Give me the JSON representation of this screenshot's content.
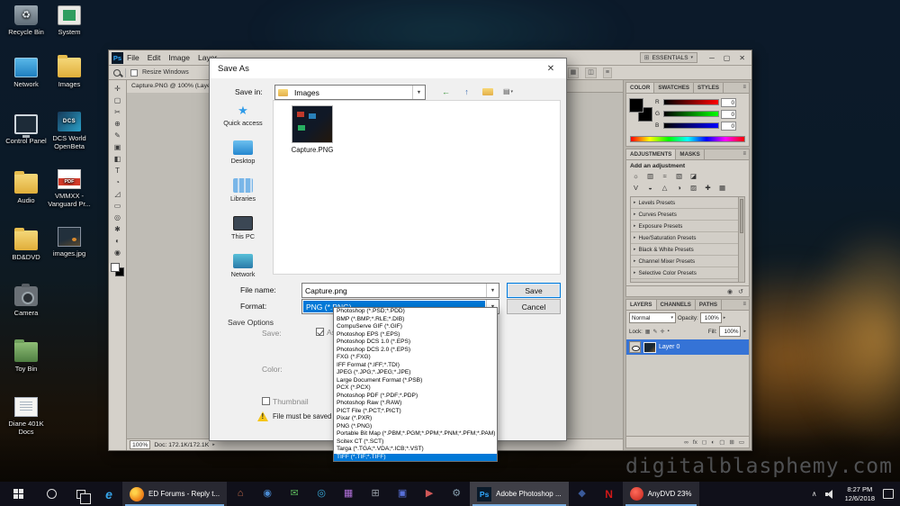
{
  "desktop": {
    "watermark": "digitalblasphemy.com",
    "icons": [
      {
        "label": "Recycle Bin",
        "type": "recycle"
      },
      {
        "label": "System",
        "type": "system"
      },
      {
        "label": "Network",
        "type": "network"
      },
      {
        "label": "Images",
        "type": "folder"
      },
      {
        "label": "Control Panel",
        "type": "monitor"
      },
      {
        "label": "DCS World OpenBeta",
        "type": "dcs"
      },
      {
        "label": "Audio",
        "type": "folder"
      },
      {
        "label": "VMMXX - Vanguard Pr...",
        "type": "pdf"
      },
      {
        "label": "BD&DVD",
        "type": "folder"
      },
      {
        "label": "images.jpg",
        "type": "image"
      },
      {
        "label": "Camera",
        "type": "camera"
      },
      {
        "label": "Toy Bin",
        "type": "greenfolder"
      },
      {
        "label": "Diane 401K Docs",
        "type": "docs"
      }
    ]
  },
  "photoshop": {
    "logo": "Ps",
    "menus": [
      "File",
      "Edit",
      "Image",
      "Layer"
    ],
    "workspace_label": "ESSENTIALS",
    "workspace_icon": "⊞",
    "window_controls": {
      "minimize": "─",
      "maximize": "▢",
      "close": "✕"
    },
    "panel_menu_icon": "≡",
    "options_bar": {
      "resize_label": "Resize Windows",
      "right_icons": [
        "▦",
        "◫",
        "≡"
      ]
    },
    "doc_tab": "Capture.PNG @ 100% (Layer 0",
    "tools": [
      "✛",
      "▢",
      "✂",
      "⊕",
      "✎",
      "▣",
      "◧",
      "T",
      "◔",
      "◿",
      "▭",
      "◎",
      "✱",
      "◐",
      "◉"
    ],
    "status": {
      "zoom": "100%",
      "doc": "Doc: 172.1K/172.1K"
    },
    "color_panel": {
      "tabs": [
        "COLOR",
        "SWATCHES",
        "STYLES"
      ],
      "channels": [
        {
          "label": "R",
          "value": "0"
        },
        {
          "label": "G",
          "value": "0"
        },
        {
          "label": "B",
          "value": "0"
        }
      ]
    },
    "adjustments_panel": {
      "tabs": [
        "ADJUSTMENTS",
        "MASKS"
      ],
      "heading": "Add an adjustment",
      "icons_row1": [
        "☼",
        "▥",
        "≈",
        "▧",
        "◪"
      ],
      "icons_row2": [
        "V",
        "◒",
        "△",
        "◑",
        "▨",
        "✚",
        "▦"
      ],
      "presets": [
        "Levels Presets",
        "Curves Presets",
        "Exposure Presets",
        "Hue/Saturation Presets",
        "Black & White Presets",
        "Channel Mixer Presets",
        "Selective Color Presets"
      ],
      "footer_icons": [
        "◉",
        "↺"
      ]
    },
    "layers_panel": {
      "tabs": [
        "LAYERS",
        "CHANNELS",
        "PATHS"
      ],
      "blend_mode": "Normal",
      "opacity_label": "Opacity:",
      "opacity_value": "100%",
      "lock_label": "Lock:",
      "lock_icons": [
        "▦",
        "✎",
        "✛",
        "▪"
      ],
      "fill_label": "Fill:",
      "fill_value": "100%",
      "layer_name": "Layer 0",
      "footer_icons": [
        "∞",
        "fx",
        "◻",
        "◐",
        "▢",
        "⊞",
        "▭"
      ]
    }
  },
  "save_dialog": {
    "title": "Save As",
    "close_icon": "✕",
    "save_in_label": "Save in:",
    "save_in_value": "Images",
    "nav_icons": {
      "back": "←",
      "up": "↑",
      "views": "▤",
      "views_caret": "▾"
    },
    "sidebar": [
      {
        "label": "Quick access",
        "type": "quick"
      },
      {
        "label": "Desktop",
        "type": "desktop"
      },
      {
        "label": "Libraries",
        "type": "libraries"
      },
      {
        "label": "This PC",
        "type": "pc"
      },
      {
        "label": "Network",
        "type": "network"
      }
    ],
    "file_item_label": "Capture.PNG",
    "file_name_label": "File name:",
    "file_name_value": "Capture.png",
    "format_label": "Format:",
    "format_value": "PNG (*.PNG)",
    "save_button": "Save",
    "cancel_button": "Cancel",
    "save_options_heading": "Save Options",
    "save_label": "Save:",
    "as_copy_label": "As a Copy",
    "color_label": "Color:",
    "thumbnail_label": "Thumbnail",
    "warning_text": "File must be saved as a copy with this selection.",
    "format_options": [
      "Photoshop (*.PSD;*.PDD)",
      "BMP (*.BMP;*.RLE;*.DIB)",
      "CompuServe GIF (*.GIF)",
      "Photoshop EPS (*.EPS)",
      "Photoshop DCS 1.0 (*.EPS)",
      "Photoshop DCS 2.0 (*.EPS)",
      "FXG (*.FXG)",
      "IFF Format (*.IFF;*.TDI)",
      "JPEG (*.JPG;*.JPEG;*.JPE)",
      "Large Document Format (*.PSB)",
      "PCX (*.PCX)",
      "Photoshop PDF (*.PDF;*.PDP)",
      "Photoshop Raw (*.RAW)",
      "PICT File (*.PCT;*.PICT)",
      "Pixar (*.PXR)",
      "PNG (*.PNG)",
      "Portable Bit Map (*.PBM;*.PGM;*.PPM;*.PNM;*.PFM;*.PAM)",
      "Scitex CT (*.SCT)",
      "Targa (*.TGA;*.VDA;*.ICB;*.VST)",
      "TIFF (*.TIF;*.TIFF)"
    ]
  },
  "taskbar": {
    "pinned_left": [
      {
        "type": "edge",
        "glyph": "e"
      }
    ],
    "firefox_button": {
      "label": "ED Forums - Reply t..."
    },
    "pinned_mid": [
      {
        "type": "home",
        "glyph": "⌂"
      },
      {
        "type": "disc",
        "glyph": "◉"
      },
      {
        "type": "mail",
        "glyph": "✉"
      },
      {
        "type": "compass",
        "glyph": "◎"
      },
      {
        "type": "store",
        "glyph": "▦"
      },
      {
        "type": "calc",
        "glyph": "⊞"
      },
      {
        "type": "photos",
        "glyph": "▣"
      },
      {
        "type": "media",
        "glyph": "▶"
      },
      {
        "type": "wrench",
        "glyph": "⚙"
      }
    ],
    "photoshop_button": {
      "icon": "Ps",
      "label": "Adobe Photoshop ..."
    },
    "pinned_right": [
      {
        "type": "navy",
        "glyph": "◆"
      },
      {
        "type": "netflix",
        "glyph": "N"
      }
    ],
    "anydvd_button": {
      "label": "AnyDVD 23%"
    },
    "tray": {
      "hidden_icons": "∧",
      "time": "8:27 PM",
      "date": "12/6/2018"
    }
  }
}
